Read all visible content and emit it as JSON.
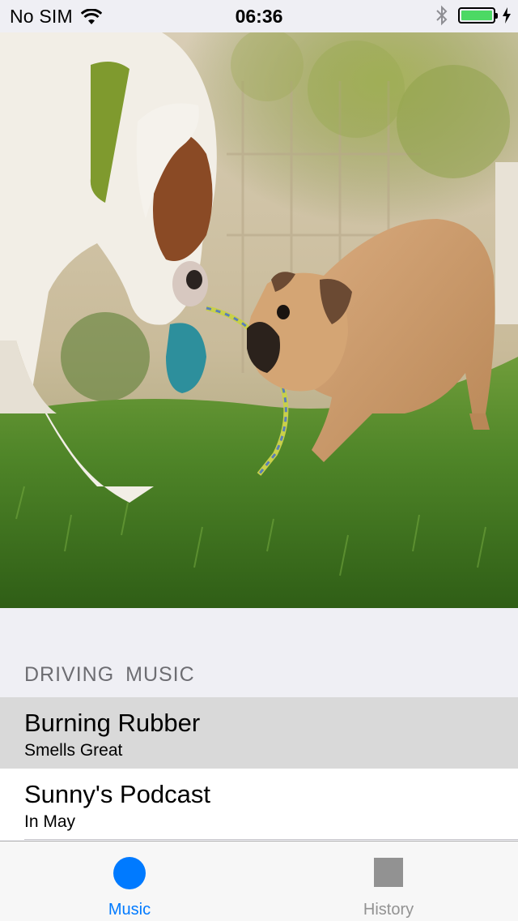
{
  "status_bar": {
    "carrier": "No SIM",
    "time": "06:36",
    "wifi_icon": "wifi-icon",
    "bluetooth_icon": "bluetooth-icon",
    "battery_icon": "battery-icon",
    "charging_icon": "charging-icon",
    "battery_level": 1.0,
    "battery_color": "#4cd964"
  },
  "hero": {
    "description_icon": "dogs-playing-photo"
  },
  "section": {
    "header": "DRIVING  MUSIC"
  },
  "list": {
    "items": [
      {
        "title": "Burning Rubber",
        "subtitle": "Smells Great",
        "selected": true
      },
      {
        "title": "Sunny's Podcast",
        "subtitle": "In May",
        "selected": false
      }
    ]
  },
  "tab_bar": {
    "tabs": [
      {
        "label": "Music",
        "icon": "circle-icon",
        "active": true,
        "color": "#007aff"
      },
      {
        "label": "History",
        "icon": "square-icon",
        "active": false,
        "color": "#929292"
      }
    ]
  }
}
